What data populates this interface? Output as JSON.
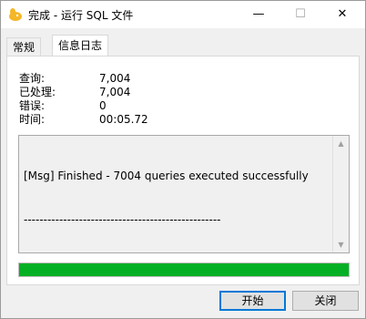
{
  "window": {
    "title": "完成 - 运行 SQL 文件",
    "controls": {
      "minimize": "—",
      "maximize": "☐",
      "close": "✕"
    }
  },
  "tabs": [
    {
      "label": "常规"
    },
    {
      "label": "信息日志"
    }
  ],
  "stats": [
    {
      "label": "查询:",
      "value": "7,004"
    },
    {
      "label": "已处理:",
      "value": "7,004"
    },
    {
      "label": "错误:",
      "value": "0"
    },
    {
      "label": "时间:",
      "value": "00:05.72"
    }
  ],
  "log": {
    "line1": "[Msg] Finished - 7004 queries executed successfully",
    "line2": "--------------------------------------------------"
  },
  "progress": {
    "fraction": 1.0,
    "color": "#06b025"
  },
  "buttons": {
    "start": "开始",
    "close": "关闭"
  },
  "colors": {
    "accent": "#0078d7"
  }
}
